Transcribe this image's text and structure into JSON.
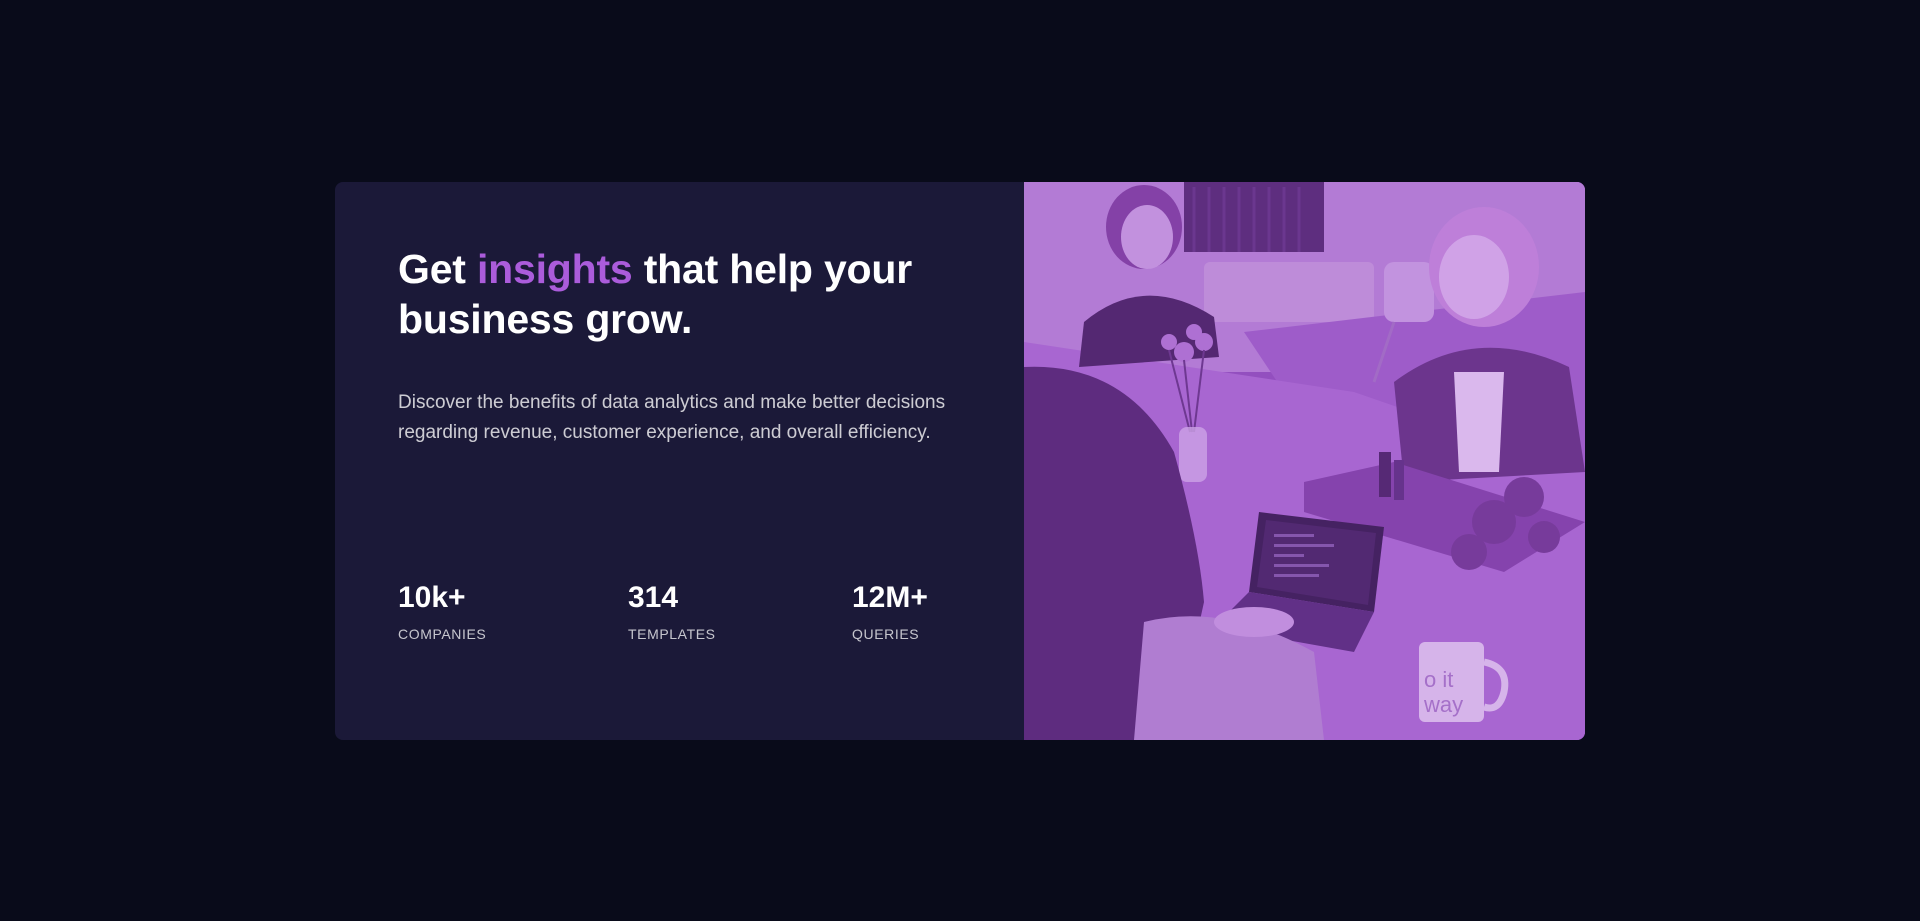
{
  "hero": {
    "headline_pre": "Get ",
    "headline_accent": "insights",
    "headline_post": " that help your business grow.",
    "description": "Discover the benefits of data analytics and make better decisions regarding revenue, customer experience, and overall efficiency.",
    "accent_color": "#ab5cdb",
    "card_color": "#1b1938",
    "page_background": "#090b1a"
  },
  "stats": [
    {
      "value": "10k+",
      "label": "COMPANIES"
    },
    {
      "value": "314",
      "label": "TEMPLATES"
    },
    {
      "value": "12M+",
      "label": "QUERIES"
    }
  ],
  "image": {
    "icon": "team-photo-image",
    "overlay_color": "#aa5cdb",
    "mug_text": "o it\nway"
  }
}
